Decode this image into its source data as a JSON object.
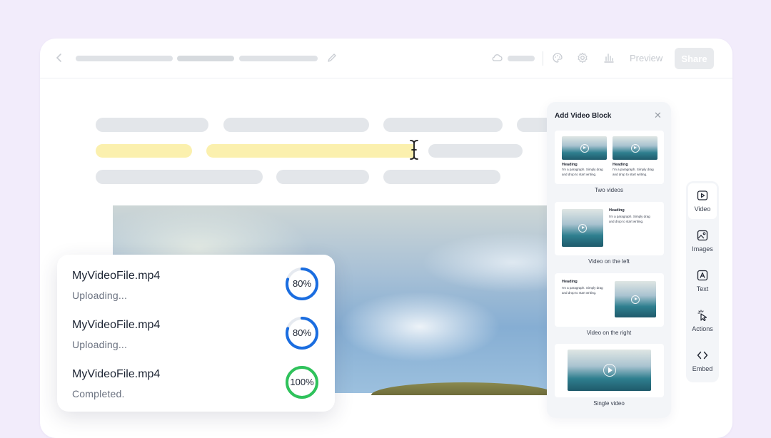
{
  "toolbar": {
    "preview_label": "Preview",
    "share_label": "Share"
  },
  "uploads": [
    {
      "file": "MyVideoFile.mp4",
      "status": "Uploading...",
      "progress_label": "80%",
      "progress": 0.8,
      "color": "#1a6de0"
    },
    {
      "file": "MyVideoFile.mp4",
      "status": "Uploading...",
      "progress_label": "80%",
      "progress": 0.8,
      "color": "#1a6de0"
    },
    {
      "file": "MyVideoFile.mp4",
      "status": "Completed.",
      "progress_label": "100%",
      "progress": 1.0,
      "color": "#2fc25b"
    }
  ],
  "panel": {
    "title": "Add Video Block",
    "close_icon": "close-icon",
    "thumb_heading": "Heading",
    "thumb_paragraph": "I'm a paragraph. Simply drag and drop to start writing.",
    "options": [
      {
        "label": "Two videos"
      },
      {
        "label": "Video on the left"
      },
      {
        "label": "Video on the right"
      },
      {
        "label": "Single video"
      }
    ]
  },
  "rail": {
    "items": [
      {
        "label": "Video",
        "icon": "video-icon",
        "active": true
      },
      {
        "label": "Images",
        "icon": "image-icon",
        "active": false
      },
      {
        "label": "Text",
        "icon": "text-icon",
        "active": false
      },
      {
        "label": "Actions",
        "icon": "cursor-click-icon",
        "active": false
      },
      {
        "label": "Embed",
        "icon": "code-icon",
        "active": false
      }
    ]
  },
  "colors": {
    "background": "#f2ecfb",
    "highlight": "#fbf0ae",
    "progress_blue": "#1a6de0",
    "progress_green": "#2fc25b"
  }
}
